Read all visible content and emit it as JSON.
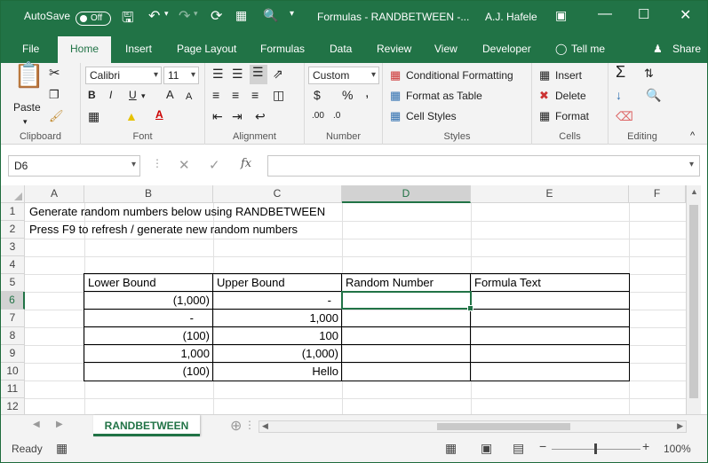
{
  "titlebar": {
    "autosave_label": "AutoSave",
    "autosave_state": "Off",
    "title": "Formulas - RANDBETWEEN  -...",
    "user": "A.J. Hafele"
  },
  "tabs": [
    "File",
    "Home",
    "Insert",
    "Page Layout",
    "Formulas",
    "Data",
    "Review",
    "Developer"
  ],
  "active_tab": "Home",
  "tell_me": "Tell me",
  "share": "Share",
  "ribbon": {
    "clipboard": {
      "paste": "Paste",
      "label": "Clipboard"
    },
    "font": {
      "name": "Calibri",
      "size": "11",
      "bold": "B",
      "italic": "I",
      "underline": "U",
      "grow": "A",
      "shrink": "A",
      "label": "Font"
    },
    "alignment": {
      "label": "Alignment"
    },
    "number": {
      "format": "Custom",
      "currency": "$",
      "percent": "%",
      "comma": ",",
      "inc_decimal": ".00",
      "dec_decimal": ".0",
      "label": "Number"
    },
    "styles": {
      "conditional": "Conditional Formatting",
      "format_table": "Format as Table",
      "cell_styles": "Cell Styles",
      "label": "Styles"
    },
    "cells": {
      "insert": "Insert",
      "delete": "Delete",
      "format": "Format",
      "label": "Cells"
    },
    "editing": {
      "label": "Editing"
    }
  },
  "formula_bar": {
    "name_box": "D6",
    "formula": ""
  },
  "columns": [
    "A",
    "B",
    "C",
    "D",
    "E",
    "F"
  ],
  "rows": [
    "1",
    "2",
    "3",
    "4",
    "5",
    "6",
    "7",
    "8",
    "9",
    "10",
    "11",
    "12"
  ],
  "cells": {
    "a1": "Generate random numbers below using RANDBETWEEN",
    "a2": "Press F9 to refresh / generate new random numbers"
  },
  "table": {
    "headers": [
      "Lower Bound",
      "Upper Bound",
      "Random Number",
      "Formula Text"
    ],
    "rows": [
      [
        "(1,000)",
        "-",
        "",
        ""
      ],
      [
        "-",
        "1,000",
        "",
        ""
      ],
      [
        "(100)",
        "100",
        "",
        ""
      ],
      [
        "1,000",
        "(1,000)",
        "",
        ""
      ],
      [
        "(100)",
        "Hello",
        "",
        ""
      ]
    ]
  },
  "sheet_tab": "RANDBETWEEN",
  "status": {
    "ready": "Ready",
    "zoom": "100%"
  },
  "colors": {
    "accent": "#217346",
    "selection": "#217346"
  }
}
